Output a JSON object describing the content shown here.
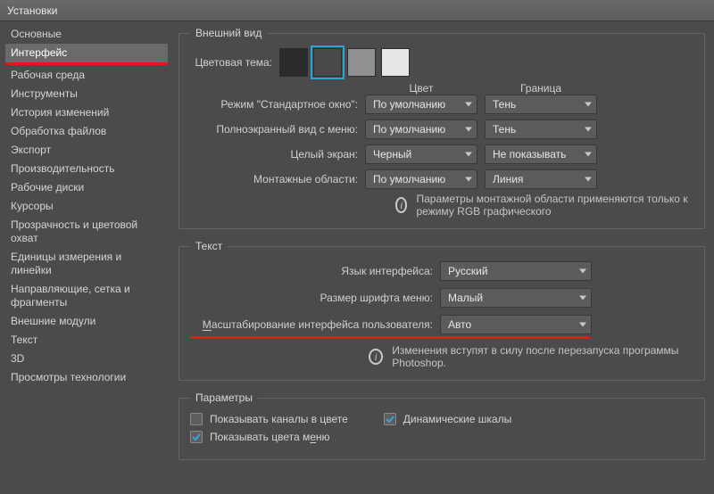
{
  "window": {
    "title": "Установки"
  },
  "sidebar": {
    "items": [
      {
        "label": "Основные"
      },
      {
        "label": "Интерфейс"
      },
      {
        "label": "Рабочая среда"
      },
      {
        "label": "Инструменты"
      },
      {
        "label": "История изменений"
      },
      {
        "label": "Обработка файлов"
      },
      {
        "label": "Экспорт"
      },
      {
        "label": "Производительность"
      },
      {
        "label": "Рабочие диски"
      },
      {
        "label": "Курсоры"
      },
      {
        "label": "Прозрачность и цветовой охват"
      },
      {
        "label": "Единицы измерения и линейки"
      },
      {
        "label": "Направляющие, сетка и фрагменты"
      },
      {
        "label": "Внешние модули"
      },
      {
        "label": "Текст"
      },
      {
        "label": "3D"
      },
      {
        "label": "Просмотры технологии"
      }
    ],
    "active_index": 1
  },
  "appearance": {
    "legend": "Внешний вид",
    "color_theme_label": "Цветовая тема:",
    "swatches": [
      "#2b2b2b",
      "#494949",
      "#909090",
      "#e6e6e6"
    ],
    "selected_swatch": 1,
    "col_color": "Цвет",
    "col_border": "Граница",
    "rows": [
      {
        "label": "Режим \"Стандартное окно\":",
        "color": "По умолчанию",
        "border": "Тень"
      },
      {
        "label": "Полноэкранный вид с меню:",
        "color": "По умолчанию",
        "border": "Тень"
      },
      {
        "label": "Целый экран:",
        "color": "Черный",
        "border": "Не показывать"
      },
      {
        "label": "Монтажные области:",
        "color": "По умолчанию",
        "border": "Линия"
      }
    ],
    "info": "Параметры монтажной области применяются только к режиму RGB графического"
  },
  "text": {
    "legend": "Текст",
    "lang_label": "Язык интерфейса:",
    "lang_value": "Русский",
    "font_label": "Размер шрифта меню:",
    "font_value": "Малый",
    "scale_prefix": "М",
    "scale_rest": "асштабирование интерфейса пользователя:",
    "scale_value": "Авто",
    "info": "Изменения вступят в силу после перезапуска программы Photoshop."
  },
  "options": {
    "legend": "Параметры",
    "channels": "Показывать каналы в цвете",
    "channels_checked": false,
    "dynamic": "Динамические шкалы",
    "dynamic_checked": true,
    "menu_prefix": "Показывать цвета м",
    "menu_u": "е",
    "menu_rest": "ню",
    "menu_checked": true
  }
}
